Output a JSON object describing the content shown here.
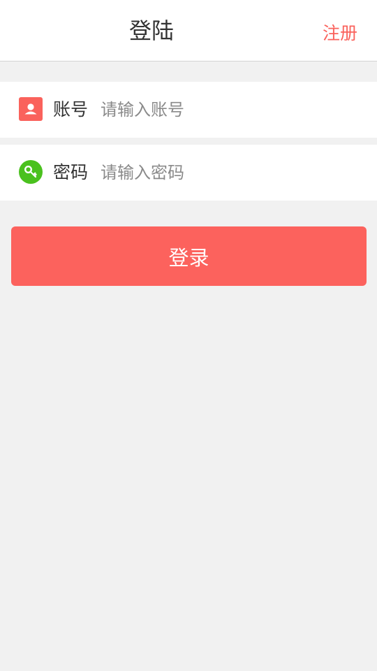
{
  "header": {
    "title": "登陆",
    "register_label": "注册"
  },
  "form": {
    "account": {
      "label": "账号",
      "placeholder": "请输入账号",
      "value": "",
      "icon": "user-card-icon",
      "icon_color": "#fa625c"
    },
    "password": {
      "label": "密码",
      "placeholder": "请输入密码",
      "value": "",
      "icon": "key-icon",
      "icon_color": "#4ac11e"
    }
  },
  "login_button": {
    "label": "登录",
    "color": "#fc625d"
  },
  "colors": {
    "accent": "#fa625c",
    "background": "#f1f1f1"
  }
}
